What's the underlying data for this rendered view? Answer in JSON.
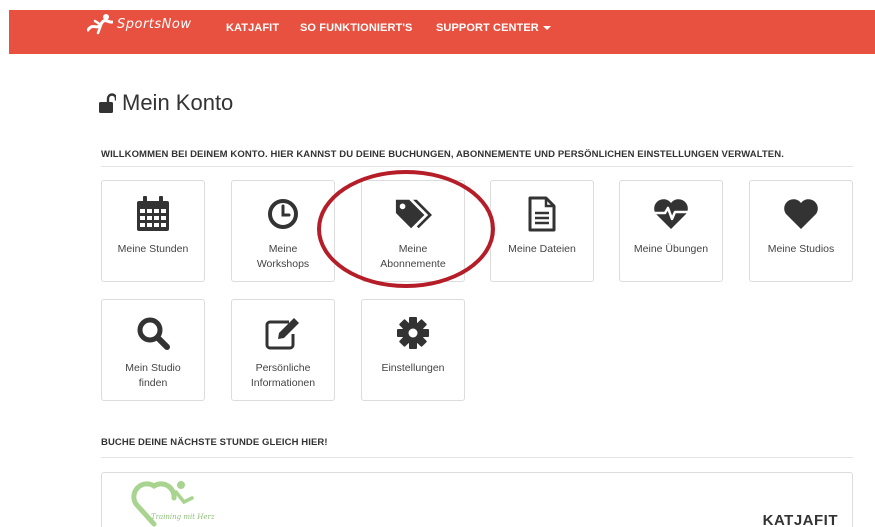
{
  "colors": {
    "brand": "#e8503f",
    "icon": "#333333",
    "annotation": "#b51d28"
  },
  "nav": {
    "logo_text": "SportsNow",
    "items": [
      {
        "label": "KATJAFIT"
      },
      {
        "label": "SO FUNKTIONIERT'S"
      },
      {
        "label": "SUPPORT CENTER",
        "dropdown": true
      }
    ]
  },
  "page": {
    "title": "Mein Konto",
    "title_icon": "unlock-icon",
    "welcome": "WILLKOMMEN BEI DEINEM KONTO. HIER KANNST DU DEINE BUCHUNGEN, ABONNEMENTE UND PERSÖNLICHEN EINSTELLUNGEN VERWALTEN."
  },
  "tiles": [
    {
      "label": "Meine Stunden",
      "icon": "calendar-icon"
    },
    {
      "label": "Meine Workshops",
      "icon": "clock-icon"
    },
    {
      "label": "Meine Abonnemente",
      "icon": "tags-icon",
      "highlighted": true
    },
    {
      "label": "Meine Dateien",
      "icon": "file-text-icon"
    },
    {
      "label": "Meine Übungen",
      "icon": "heartbeat-icon"
    },
    {
      "label": "Meine Studios",
      "icon": "heart-icon"
    },
    {
      "label": "Mein Studio finden",
      "icon": "search-icon"
    },
    {
      "label": "Persönliche Informationen",
      "icon": "edit-icon"
    },
    {
      "label": "Einstellungen",
      "icon": "cog-icon"
    }
  ],
  "booking": {
    "heading": "BUCHE DEINE NÄCHSTE STUNDE GLEICH HIER!",
    "studio_name": "KATJAFIT",
    "studio_tagline": "Training mit Herz"
  }
}
